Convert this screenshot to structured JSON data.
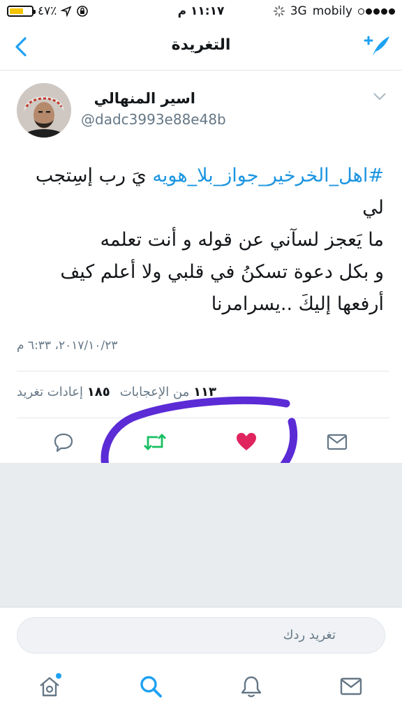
{
  "status": {
    "battery": "٤٧٪",
    "time": "١١:١٧ م",
    "network": "3G",
    "carrier": "mobily"
  },
  "nav": {
    "title": "التغريدة"
  },
  "tweet": {
    "name": "اسير المنهالي",
    "handle": "@dadc3993e88e48b",
    "hashtag": "#اهل_الخرخير_جواز_بلا_هويه",
    "text": "يَ رب إسِتجب لي\nما يَعجز لسآني عن قوله و أنت تعلمه\nو بكل دعوة تسكنُ في قلبي ولا أعلم كيف أرفعها إليكَ ..يسرامرنا",
    "date": "٢٠١٧/١٠/٢٣، ٦:٣٣ م",
    "likes_count": "١١٣",
    "likes_label": "من الإعجابات",
    "retweets_count": "١٨٥",
    "retweets_label": "إعادات تغريد"
  },
  "reply": {
    "placeholder": "تغريد ردك"
  },
  "colors": {
    "accent": "#1da1f2",
    "retweet": "#17bf63",
    "like": "#e0245e",
    "annotation": "#5b2bd6"
  },
  "icons": [
    "back-chevron-icon",
    "compose-icon",
    "reply-icon",
    "retweet-icon",
    "heart-icon",
    "message-icon",
    "home-icon",
    "search-icon",
    "bell-icon",
    "mail-icon"
  ]
}
